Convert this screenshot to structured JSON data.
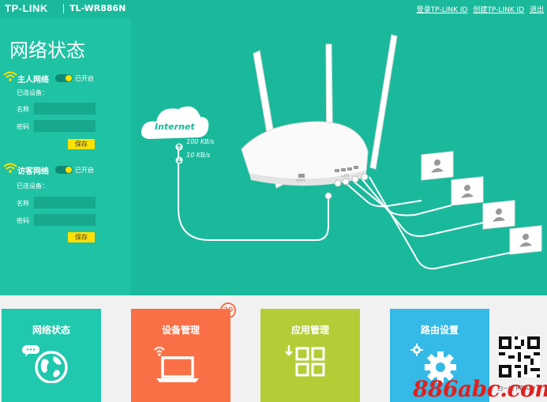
{
  "header": {
    "brand": "TP-LINK",
    "model": "TL-WR886N",
    "login_link": "登录TP-LINK ID",
    "create_link": "创建TP-LINK ID",
    "logout_link": "退出"
  },
  "left": {
    "title": "网络状态",
    "main_network": {
      "name": "主人网络",
      "status": "已开启",
      "connected_label": "已连设备：",
      "ssid_label": "名称",
      "ssid_value": "",
      "password_label": "密码",
      "password_value": "",
      "save_label": "保存"
    },
    "guest_network": {
      "name": "访客网络",
      "status": "已开启",
      "connected_label": "已连设备：",
      "ssid_label": "名称",
      "ssid_value": "",
      "password_label": "密码",
      "password_value": "",
      "save_label": "保存"
    }
  },
  "diagram": {
    "cloud_label": "Internet",
    "upload_speed": "100 KB/s",
    "download_speed": "10 KB/s",
    "wan_label": "WAN",
    "lan_label": "LAN",
    "client_count_shown": 4
  },
  "tiles": [
    {
      "label": "网络状态",
      "icon": "globe-chat-icon",
      "color": "#20c8ae"
    },
    {
      "label": "设备管理",
      "icon": "laptop-wifi-icon",
      "color": "#fa7046",
      "badge": "20"
    },
    {
      "label": "应用管理",
      "icon": "apps-grid-icon",
      "color": "#b4cd37"
    },
    {
      "label": "路由设置",
      "icon": "gear-icon",
      "color": "#35b9e6"
    }
  ],
  "qr": {
    "caption": "扫一扫下载APP"
  },
  "watermark": "886abc.com",
  "colors": {
    "teal": "#1bb99c",
    "panel": "#20c2a4",
    "yellow": "#ffe000"
  }
}
